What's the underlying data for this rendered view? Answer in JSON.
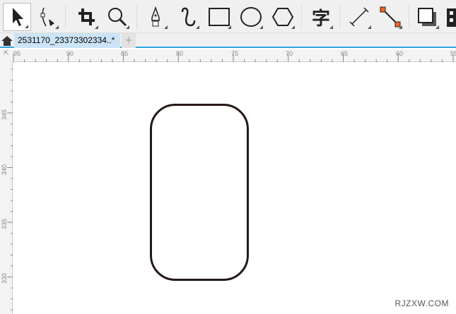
{
  "toolbar": {
    "tools": [
      "pick-tool",
      "shape-edit-tool",
      "crop-tool",
      "zoom-tool",
      "pen-tool",
      "freehand-tool",
      "rectangle-tool",
      "ellipse-tool",
      "polygon-tool",
      "text-tool",
      "dimension-tool",
      "connector-tool",
      "drop-shadow-tool",
      "transparency-tool"
    ],
    "text_tool_glyph": "字"
  },
  "tabs": {
    "document": "2531170_23373302334..*",
    "add": "+"
  },
  "ruler": {
    "horizontal": [
      "95",
      "90",
      "85",
      "80",
      "75",
      "70",
      "65",
      "60",
      "55"
    ],
    "vertical": [
      "345",
      "340",
      "335",
      "330"
    ]
  },
  "watermark": "RJZXW.COM"
}
